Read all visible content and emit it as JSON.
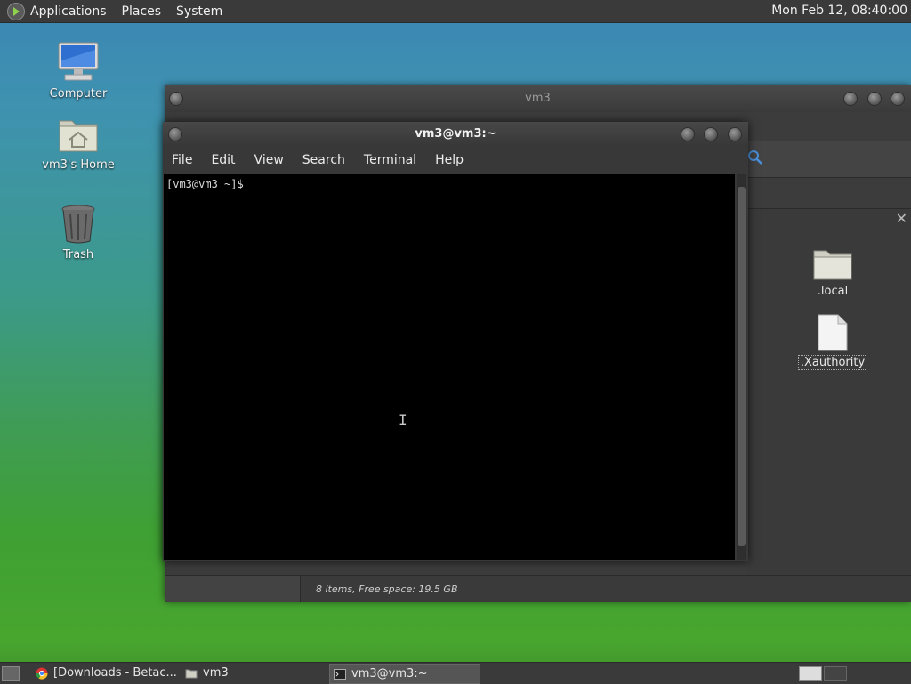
{
  "top_panel": {
    "menus": [
      "Applications",
      "Places",
      "System"
    ],
    "clock": "Mon Feb 12, 08:40:00"
  },
  "desktop": {
    "icons": [
      {
        "label": "Computer",
        "icon": "computer-icon"
      },
      {
        "label": "vm3's Home",
        "icon": "home-folder-icon"
      },
      {
        "label": "Trash",
        "icon": "trash-icon"
      }
    ]
  },
  "file_manager": {
    "title": "vm3",
    "files": [
      {
        "name": ".local",
        "icon": "folder-icon"
      },
      {
        "name": ".Xauthority",
        "icon": "file-icon"
      }
    ],
    "status": "8 items, Free space: 19.5 GB"
  },
  "terminal": {
    "title": "vm3@vm3:~",
    "menu": [
      "File",
      "Edit",
      "View",
      "Search",
      "Terminal",
      "Help"
    ],
    "prompt": "[vm3@vm3 ~]$"
  },
  "taskbar": {
    "tasks": [
      {
        "label": "[Downloads - Betac...",
        "icon": "chrome-icon"
      },
      {
        "label": "vm3",
        "icon": "folder-icon"
      },
      {
        "label": "vm3@vm3:~",
        "icon": "terminal-icon",
        "active": true
      }
    ]
  }
}
